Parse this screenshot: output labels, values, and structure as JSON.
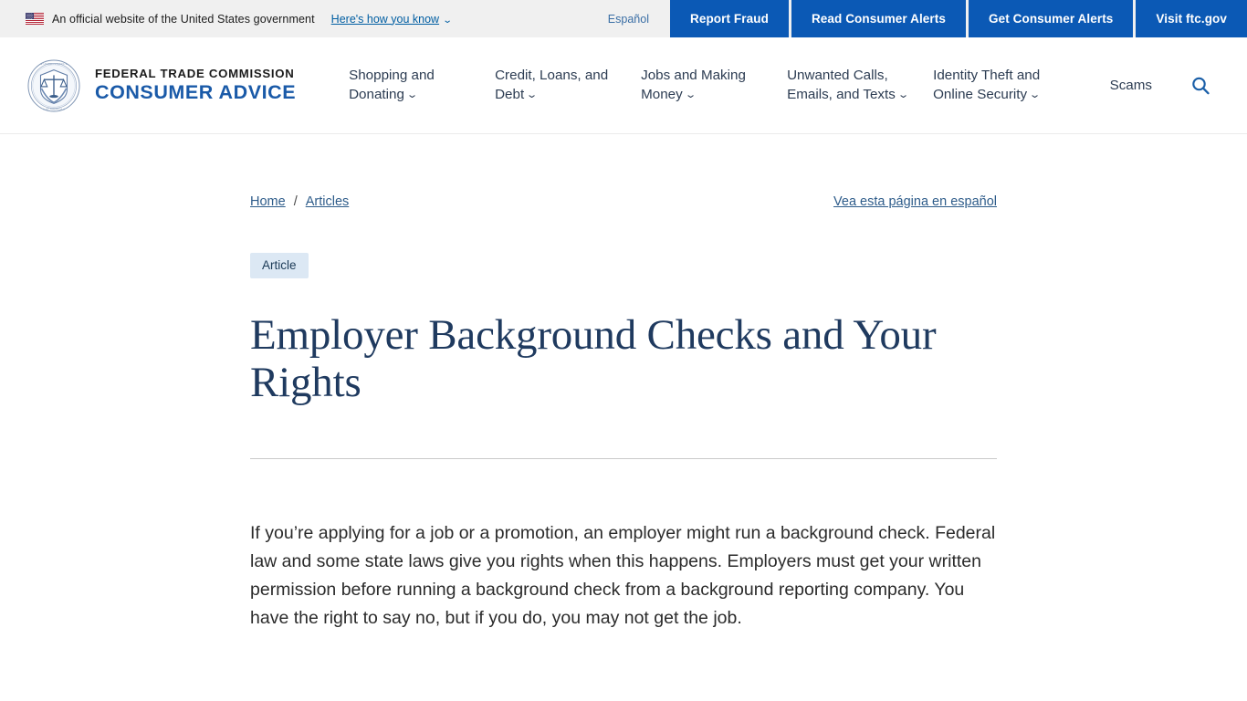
{
  "gov_banner": {
    "flag_icon": "us-flag-icon",
    "text": "An official website of the United States government",
    "how_you_know": "Here's how you know",
    "chevron": "⌄",
    "espanol": "Español",
    "buttons": [
      {
        "label": "Report Fraud"
      },
      {
        "label": "Read Consumer Alerts"
      },
      {
        "label": "Get Consumer Alerts"
      },
      {
        "label": "Visit ftc.gov"
      }
    ],
    "bar_bg": "#f0f0f0",
    "button_bg": "#0b59b5"
  },
  "header": {
    "logo_icon": "ftc-seal-icon",
    "brand_line1": "FEDERAL TRADE COMMISSION",
    "brand_line2": "CONSUMER ADVICE",
    "brand_color": "#1a5aa8",
    "nav": [
      {
        "label": "Shopping and Donating",
        "chevron": "⌄",
        "has_dropdown": true
      },
      {
        "label": "Credit, Loans, and Debt",
        "chevron": "⌄",
        "has_dropdown": true
      },
      {
        "label": "Jobs and Making Money",
        "chevron": "⌄",
        "has_dropdown": true
      },
      {
        "label": "Unwanted Calls, Emails, and Texts",
        "chevron": "⌄",
        "has_dropdown": true
      },
      {
        "label": "Identity Theft and Online Security",
        "chevron": "⌄",
        "has_dropdown": true
      }
    ],
    "scams_label": "Scams",
    "search_icon": "search-icon"
  },
  "main": {
    "breadcrumb": {
      "home": "Home",
      "separator": "/",
      "current": "Articles"
    },
    "espanol_page_link": "Vea esta página en español",
    "badge": "Article",
    "title": "Employer Background Checks and Your Rights",
    "title_color": "#1f3a5f",
    "paragraph": "If you’re applying for a job or a promotion, an employer might run a background check. Federal law and some state laws give you rights when this happens. Employers must get your written permission before running a background check from a background reporting company. You have the right to say no, but if you do, you may not get the job."
  }
}
